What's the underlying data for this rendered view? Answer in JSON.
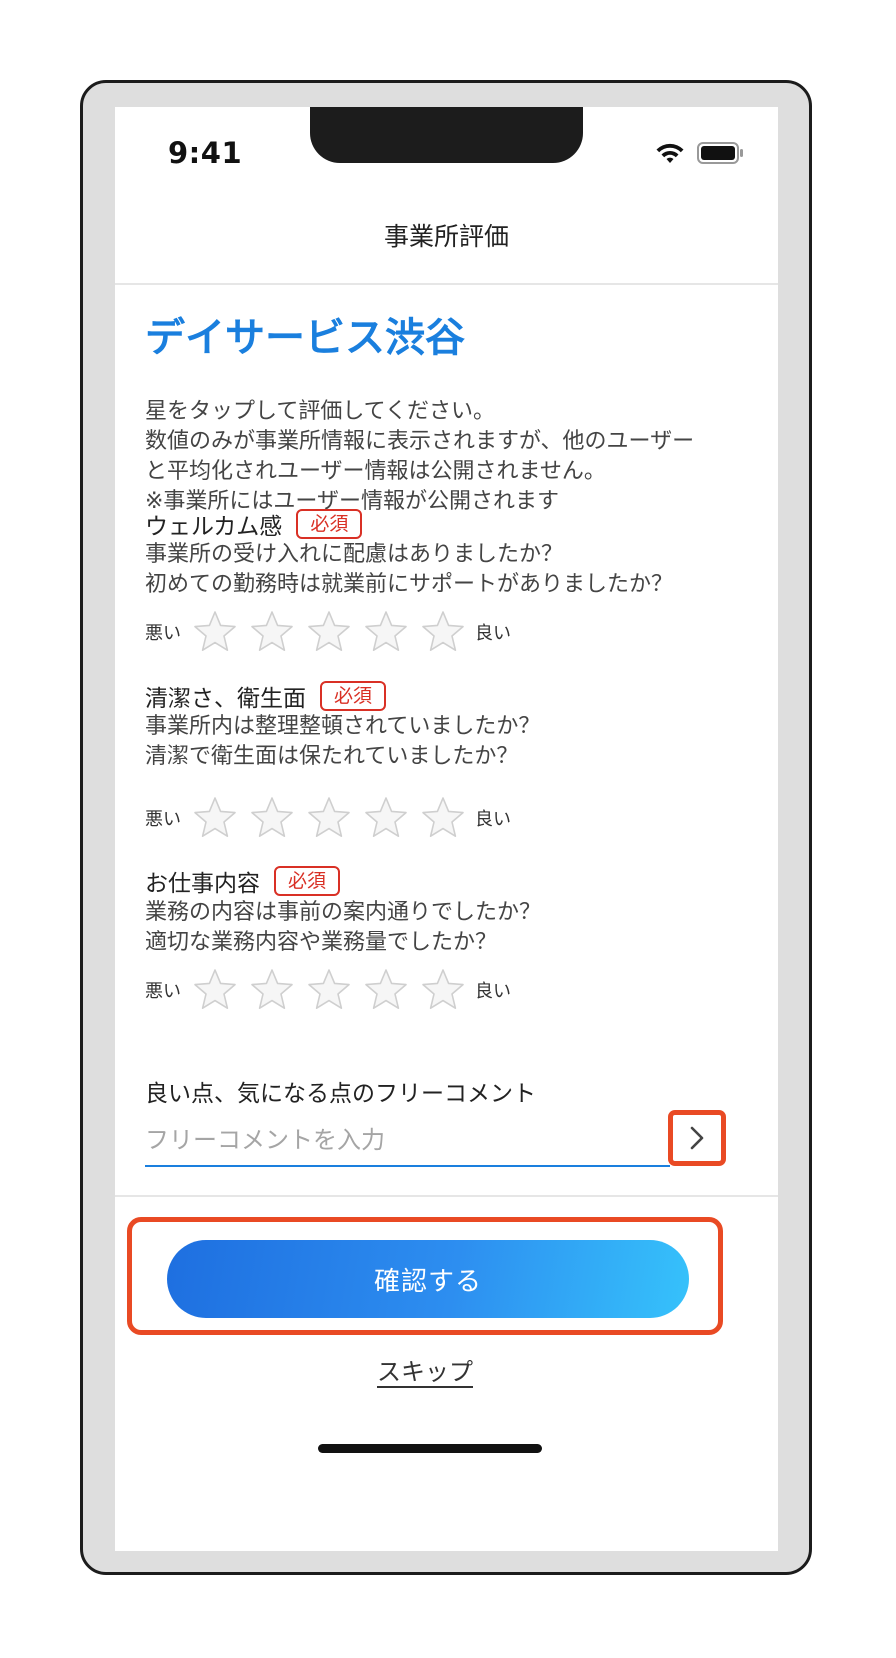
{
  "status_bar": {
    "time": "9:41"
  },
  "header": {
    "title": "事業所評価"
  },
  "facility": {
    "name": "デイサービス渋谷"
  },
  "instructions": [
    "星をタップして評価してください。",
    "数値のみが事業所情報に表示されますが、他のユーザー",
    "と平均化されユーザー情報は公開されません。",
    "※事業所にはユーザー情報が公開されます"
  ],
  "rating_labels": {
    "bad": "悪い",
    "good": "良い"
  },
  "required_label": "必須",
  "sections": [
    {
      "title": "ウェルカム感",
      "questions": [
        "事業所の受け入れに配慮はありましたか？",
        "初めての勤務時は就業前にサポートがありましたか？"
      ],
      "rating": 0
    },
    {
      "title": "清潔さ、衛生面",
      "questions": [
        "事業所内は整理整頓されていましたか？",
        "清潔で衛生面は保たれていましたか？"
      ],
      "rating": 0
    },
    {
      "title": "お仕事内容",
      "questions": [
        "業務の内容は事前の案内通りでしたか？",
        "適切な業務内容や業務量でしたか？"
      ],
      "rating": 0
    }
  ],
  "comment": {
    "label": "良い点、気になる点のフリーコメント",
    "placeholder": "フリーコメントを入力",
    "value": ""
  },
  "actions": {
    "confirm_label": "確認する",
    "skip_label": "スキップ"
  },
  "colors": {
    "accent": "#1a7fde",
    "required": "#d93025",
    "highlight": "#e94a24"
  }
}
